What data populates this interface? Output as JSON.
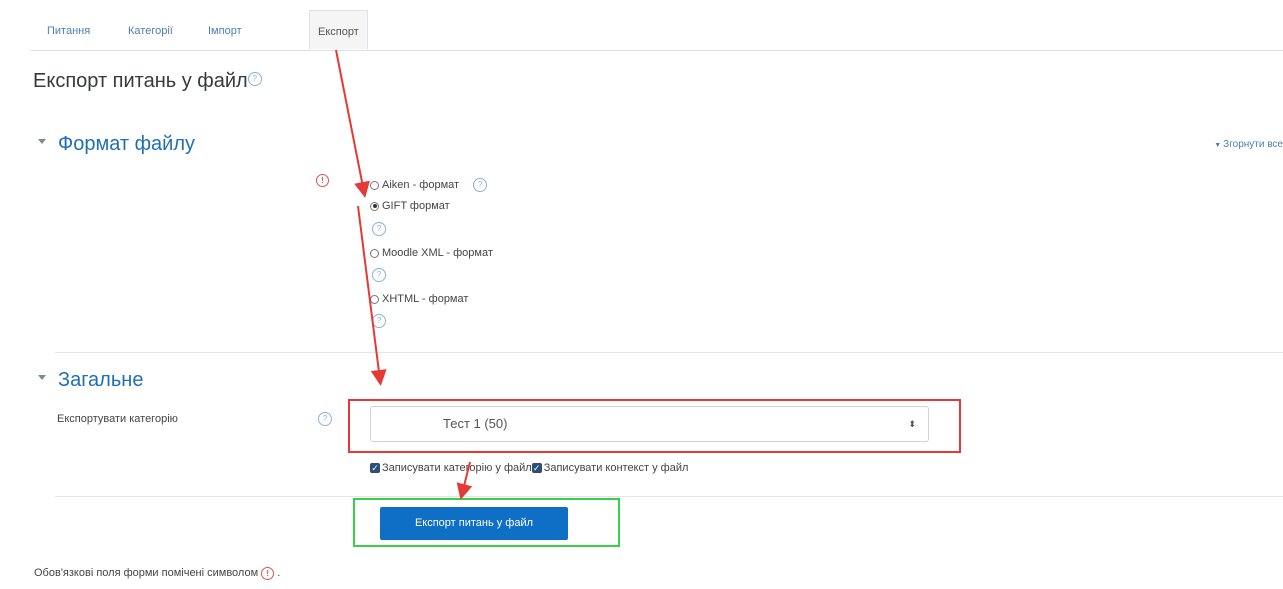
{
  "tabs": [
    {
      "label": "Питання",
      "active": false
    },
    {
      "label": "Категорії",
      "active": false
    },
    {
      "label": "Імпорт",
      "active": false
    },
    {
      "label": "Експорт",
      "active": true
    }
  ],
  "page_title": "Експорт питань у файл",
  "collapse_all": "Згорнути все",
  "format_section": {
    "title": "Формат файлу",
    "options": [
      {
        "label": "Aiken - формат",
        "checked": false
      },
      {
        "label": "GIFT формат",
        "checked": true
      },
      {
        "label": "Moodle XML - формат",
        "checked": false
      },
      {
        "label": "XHTML - формат",
        "checked": false
      }
    ]
  },
  "general_section": {
    "title": "Загальне",
    "category_label": "Експортувати категорію",
    "category_value": "Тест 1 (50)",
    "checkbox_category": "Записувати категорію у файл",
    "checkbox_context": "Записувати контекст у файл"
  },
  "submit_label": "Експорт питань у файл",
  "required_note": "Обов'язкові поля форми помічені символом",
  "required_note_end": ".",
  "glyphs": {
    "help": "?",
    "required": "!",
    "select_arrow": "⬍",
    "check": "✓"
  },
  "colors": {
    "accent": "#0f6fc5",
    "annotation_red": "#e53935",
    "annotation_green": "#35d24a"
  }
}
